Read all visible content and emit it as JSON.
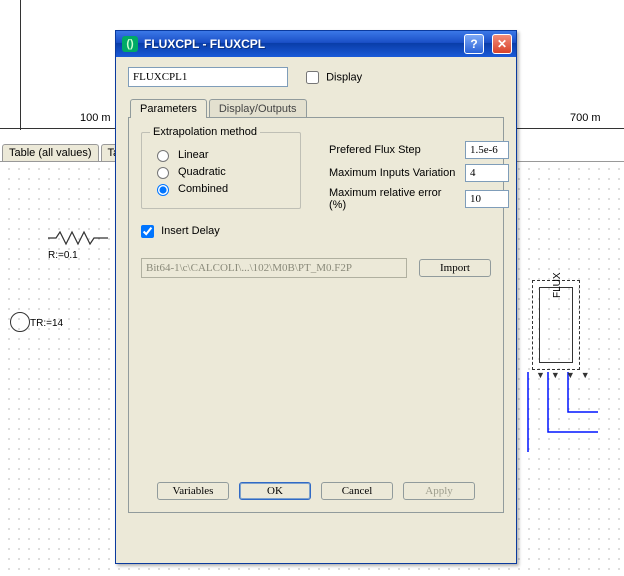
{
  "background": {
    "axis_left_label": "100 m",
    "axis_right_label": "700 m",
    "tabs": [
      "Table (all values)",
      "Ta"
    ],
    "resistor_label": "R:=0.1",
    "t_label": "TR:=14",
    "flux_label": "FLUX"
  },
  "dialog": {
    "title": "FLUXCPL - FLUXCPL",
    "name_value": "FLUXCPL1",
    "display_checkbox_label": "Display",
    "display_checked": false,
    "tabs": {
      "parameters": "Parameters",
      "display_outputs": "Display/Outputs",
      "active": "parameters"
    },
    "extrapolation": {
      "legend": "Extrapolation method",
      "options": {
        "linear": "Linear",
        "quadratic": "Quadratic",
        "combined": "Combined"
      },
      "selected": "combined"
    },
    "fields": {
      "prefered_flux_step": {
        "label": "Prefered Flux Step",
        "value": "1.5e-6"
      },
      "max_inputs_variation": {
        "label": "Maximum Inputs Variation",
        "value": "4"
      },
      "max_rel_error": {
        "label": "Maximum relative error (%)",
        "value": "10"
      }
    },
    "insert_delay": {
      "label": "Insert Delay",
      "checked": true
    },
    "path": {
      "value": "Bit64-1\\c\\CALCOLI\\...\\102\\M0B\\PT_M0.F2P",
      "import_label": "Import"
    },
    "buttons": {
      "variables": "Variables",
      "ok": "OK",
      "cancel": "Cancel",
      "apply": "Apply"
    }
  }
}
